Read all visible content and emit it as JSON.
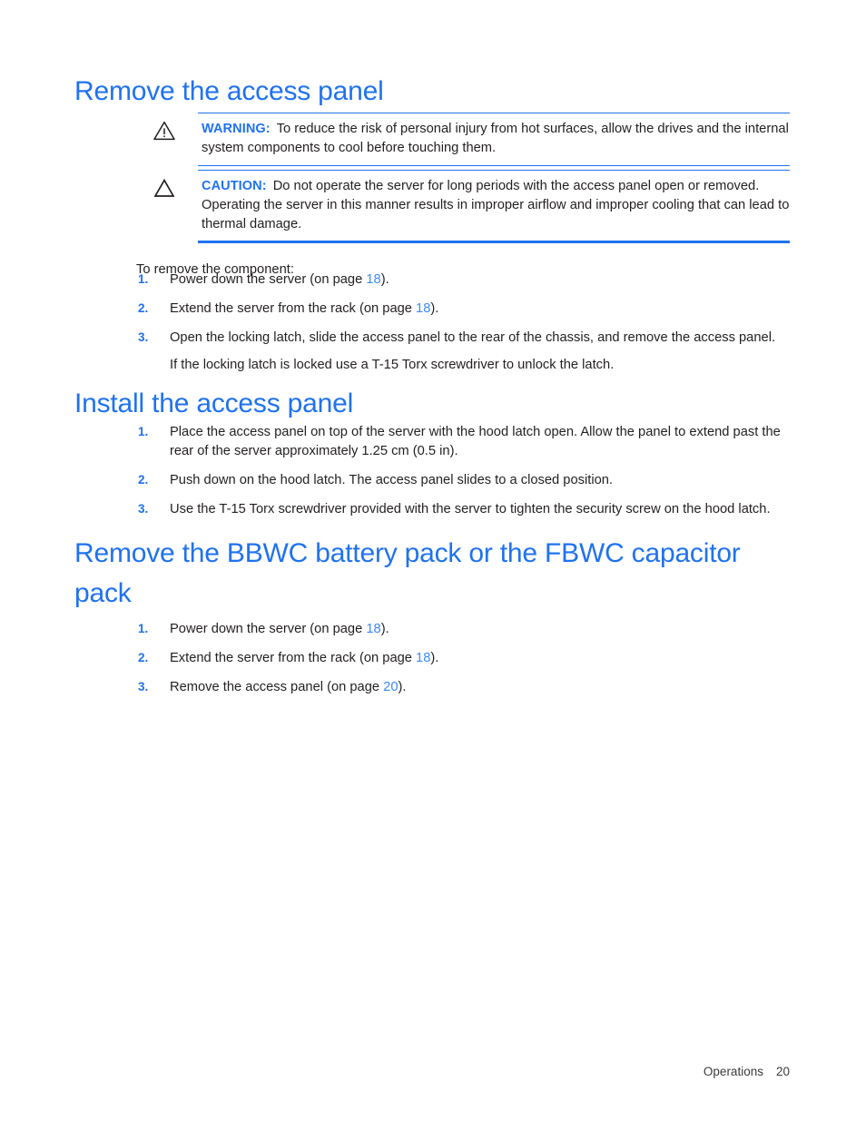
{
  "colors": {
    "heading_blue": "#1f72f0",
    "link_blue": "#3d8bf2",
    "rule_blue": "#1f72f0",
    "body_text": "#231f20"
  },
  "sections": [
    {
      "heading": "Remove the access panel",
      "alerts": [
        {
          "icon": "warning-triangle-exclamation-icon",
          "label": "WARNING:",
          "text": "To reduce the risk of personal injury from hot surfaces, allow the drives and the internal system components to cool before touching them."
        },
        {
          "icon": "caution-triangle-icon",
          "label": "CAUTION:",
          "text": "Do not operate the server for long periods with the access panel open or removed. Operating the server in this manner results in improper airflow and improper cooling that can lead to thermal damage."
        }
      ],
      "intro": "To remove the component:",
      "steps": [
        {
          "number": "1.",
          "text_before": "Power down the server (on page ",
          "xref": "18",
          "text_after": ")."
        },
        {
          "number": "2.",
          "text_before": "Extend the server from the rack (on page ",
          "xref": "18",
          "text_after": ")."
        },
        {
          "number": "3.",
          "text_before": "Open the locking latch, slide the access panel to the rear of the chassis, and remove the access panel.",
          "xref": "",
          "text_after": "",
          "sub_text": "If the locking latch is locked use a T-15 Torx screwdriver to unlock the latch."
        }
      ]
    },
    {
      "heading": "Install the access panel",
      "steps": [
        {
          "number": "1.",
          "text_before": "Place the access panel on top of the server with the hood latch open. Allow the panel to extend past the rear of the server approximately 1.25 cm (0.5 in).",
          "xref": "",
          "text_after": ""
        },
        {
          "number": "2.",
          "text_before": "Push down on the hood latch. The access panel slides to a closed position.",
          "xref": "",
          "text_after": ""
        },
        {
          "number": "3.",
          "text_before": "Use the T-15 Torx screwdriver provided with the server to tighten the security screw on the hood latch.",
          "xref": "",
          "text_after": ""
        }
      ]
    },
    {
      "heading": "Remove the BBWC battery pack or the FBWC capacitor pack",
      "steps": [
        {
          "number": "1.",
          "text_before": "Power down the server (on page ",
          "xref": "18",
          "text_after": ")."
        },
        {
          "number": "2.",
          "text_before": "Extend the server from the rack (on page ",
          "xref": "18",
          "text_after": ")."
        },
        {
          "number": "3.",
          "text_before": "Remove the access panel (on page ",
          "xref": "20",
          "text_after": ")."
        }
      ]
    }
  ],
  "footer": {
    "chapter": "Operations",
    "page_number": "20"
  }
}
